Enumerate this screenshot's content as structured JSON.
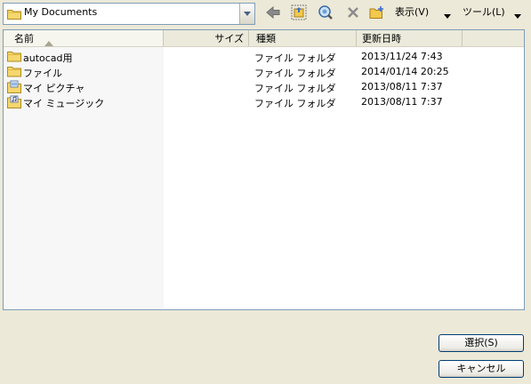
{
  "toolbar": {
    "location": "My Documents",
    "view_label": "表示(V)",
    "tools_label": "ツール(L)"
  },
  "columns": {
    "name": "名前",
    "size": "サイズ",
    "type": "種類",
    "date": "更新日時"
  },
  "files": [
    {
      "name": "autocad用",
      "size": "",
      "type": "ファイル フォルダ",
      "date": "2013/11/24 7:43",
      "icon": "folder-icon"
    },
    {
      "name": "ファイル",
      "size": "",
      "type": "ファイル フォルダ",
      "date": "2014/01/14 20:25",
      "icon": "folder-icon"
    },
    {
      "name": "マイ ピクチャ",
      "size": "",
      "type": "ファイル フォルダ",
      "date": "2013/08/11 7:37",
      "icon": "pictures-folder-icon"
    },
    {
      "name": "マイ ミュージック",
      "size": "",
      "type": "ファイル フォルダ",
      "date": "2013/08/11 7:37",
      "icon": "music-folder-icon"
    }
  ],
  "buttons": {
    "select": "選択(S)",
    "cancel": "キャンセル"
  }
}
